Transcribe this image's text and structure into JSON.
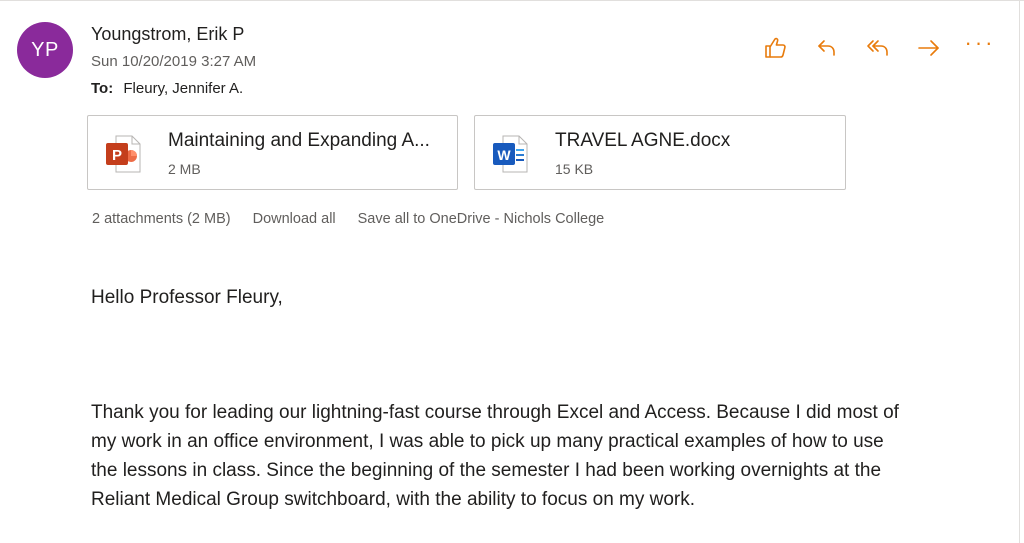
{
  "header": {
    "avatar_initials": "YP",
    "avatar_color": "#8a2a9b",
    "sender_name": "Youngstrom, Erik P",
    "date": "Sun 10/20/2019 3:27 AM",
    "to_label": "To:",
    "to_value": "Fleury, Jennifer A."
  },
  "actions": {
    "accent_color": "#e87b0c",
    "items": [
      {
        "name": "like",
        "icon": "thumbs-up-icon"
      },
      {
        "name": "reply",
        "icon": "reply-icon"
      },
      {
        "name": "reply-all",
        "icon": "reply-all-icon"
      },
      {
        "name": "forward",
        "icon": "forward-icon"
      },
      {
        "name": "more",
        "icon": "more-icon",
        "glyph": "···"
      }
    ]
  },
  "attachments": [
    {
      "name": "Maintaining and Expanding A...",
      "size": "2 MB",
      "icon": "powerpoint-icon",
      "icon_color": "#c43e1c"
    },
    {
      "name": "TRAVEL AGNE.docx",
      "size": "15 KB",
      "icon": "word-icon",
      "icon_color": "#185abd"
    }
  ],
  "attachment_footer": {
    "count": "2 attachments (2 MB)",
    "download_all": "Download all",
    "save_all": "Save all to OneDrive - Nichols College"
  },
  "body": {
    "greeting": "Hello Professor Fleury,",
    "lines": [
      "Thank you for leading our lightning-fast course through Excel and Access. Because I did most of",
      "my work in an office environment, I was able to pick up many practical examples of how to use",
      "the lessons in class. Since the beginning of the semester I had been working overnights at the",
      "Reliant Medical Group switchboard, with the ability to focus on my work."
    ]
  }
}
